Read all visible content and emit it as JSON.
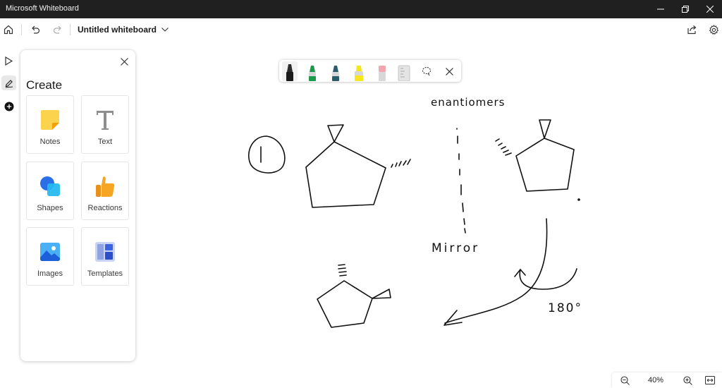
{
  "window": {
    "title": "Microsoft Whiteboard",
    "controls": [
      "minimize-icon",
      "restore-icon",
      "close-icon"
    ]
  },
  "toolbar": {
    "board_name": "Untitled whiteboard",
    "left_icons": [
      "home-icon",
      "undo-icon",
      "redo-icon",
      "chevron-down-icon"
    ],
    "right_icons": [
      "share-icon",
      "settings-icon"
    ]
  },
  "rail": {
    "items": [
      {
        "icon": "select-cursor-icon"
      },
      {
        "icon": "pen-icon",
        "active": true
      },
      {
        "icon": "add-icon"
      }
    ]
  },
  "create_panel": {
    "title": "Create",
    "tiles": [
      {
        "label": "Notes",
        "icon": "sticky-note-icon"
      },
      {
        "label": "Text",
        "icon": "text-icon"
      },
      {
        "label": "Shapes",
        "icon": "shapes-icon"
      },
      {
        "label": "Reactions",
        "icon": "thumbs-up-icon"
      },
      {
        "label": "Images",
        "icon": "image-icon"
      },
      {
        "label": "Templates",
        "icon": "templates-icon"
      }
    ]
  },
  "pen_toolbar": {
    "tools": [
      {
        "name": "black-pen",
        "color": "#1b1b1b",
        "selected": true
      },
      {
        "name": "green-pen",
        "color": "#1a9a4a"
      },
      {
        "name": "teal-pen",
        "color": "#2b5c6c"
      },
      {
        "name": "yellow-highlighter",
        "color": "#f5e61e"
      },
      {
        "name": "pink-eraser",
        "color": "#f2a7b0"
      },
      {
        "name": "ruler",
        "color": "#cfcfcf"
      },
      {
        "name": "lasso",
        "color": "#444444"
      }
    ]
  },
  "canvas_text": {
    "enantiomers": "enantiomers",
    "mirror": "Mirror",
    "degrees": "180°"
  },
  "zoom": {
    "level": "40%"
  },
  "colors": {
    "titlebar": "#202020",
    "ink": "#111111",
    "notes_yellow": "#fcd34d",
    "shapes_blue": "#2b7cf0",
    "reactions_orange": "#f6a623"
  }
}
